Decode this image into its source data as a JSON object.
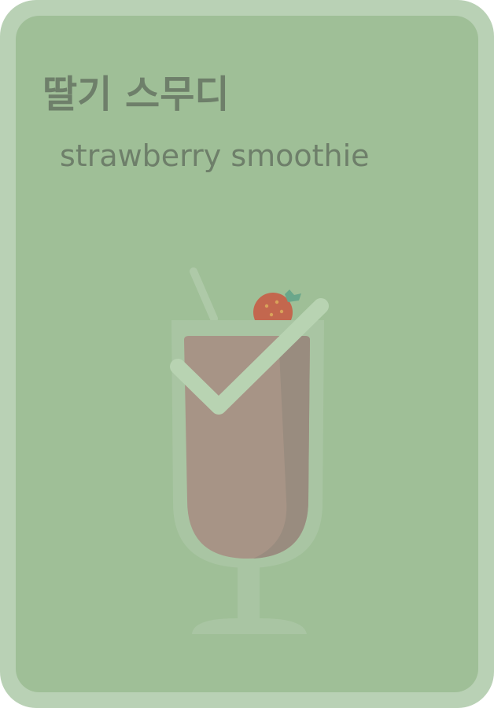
{
  "card": {
    "word_korean": "딸기 스무디",
    "word_english": "strawberry smoothie",
    "illustration_icon": "strawberry-smoothie-icon",
    "status_icon": "checkmark-icon",
    "completed": true
  },
  "colors": {
    "frame": "#b9d1b5",
    "face": "#9fbf97",
    "text": "#6e7f6a",
    "smoothie": "#a79486",
    "strawberry": "#c3674e",
    "checkmark": "#b8d3b2"
  }
}
